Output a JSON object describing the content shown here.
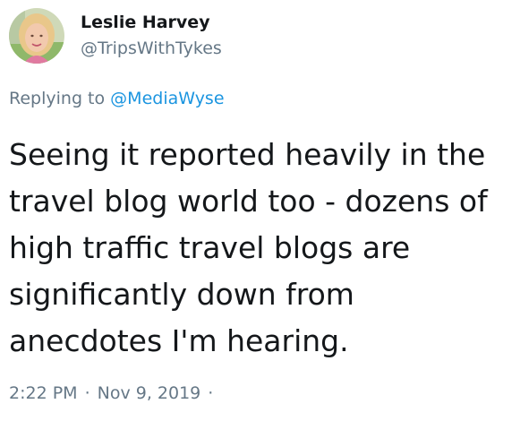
{
  "tweet": {
    "author": {
      "display_name": "Leslie Harvey",
      "handle": "@TripsWithTykes",
      "avatar_icon": "profile-photo"
    },
    "reply": {
      "prefix": "Replying to",
      "mention": "@MediaWyse"
    },
    "text": "Seeing it reported heavily in the\ntravel blog world too - dozens of\nhigh traffic travel blogs are\nsignificantly down from\nanecdotes I'm hearing.",
    "time": "2:22 PM",
    "date": "Nov 9, 2019",
    "separator": "·"
  },
  "colors": {
    "text": "#14171a",
    "muted": "#657786",
    "link": "#1b95e0"
  }
}
